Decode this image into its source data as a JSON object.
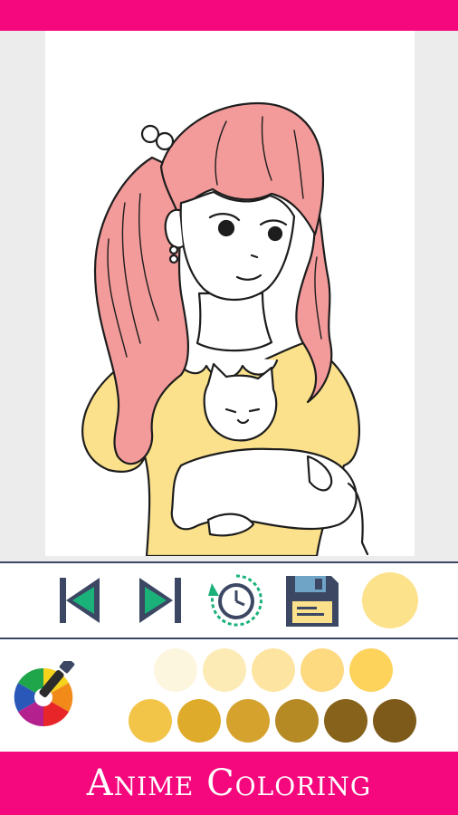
{
  "app": {
    "title": "Anime Coloring"
  },
  "colors": {
    "top_bar": "#f5087e",
    "bottom_bar": "#f5087e",
    "toolbar_border": "#3b4763",
    "hair_fill": "#f39a9a",
    "dress_fill": "#fbe18b"
  },
  "toolbar": {
    "buttons": [
      {
        "name": "previous-button",
        "icon": "skip-previous-icon"
      },
      {
        "name": "next-button",
        "icon": "skip-next-icon"
      },
      {
        "name": "history-button",
        "icon": "clock-history-icon"
      },
      {
        "name": "save-button",
        "icon": "floppy-disk-icon"
      }
    ],
    "current_color": "#fde28c"
  },
  "palette": {
    "picker_icon": "color-wheel-brush-icon",
    "row1": [
      "#fdf6df",
      "#fdebb6",
      "#fde4a0",
      "#fdd97f",
      "#fdd35c"
    ],
    "row2": [
      "#f2c549",
      "#dfab2a",
      "#d5a22d",
      "#b58a25",
      "#86621a",
      "#7d5a19"
    ]
  }
}
